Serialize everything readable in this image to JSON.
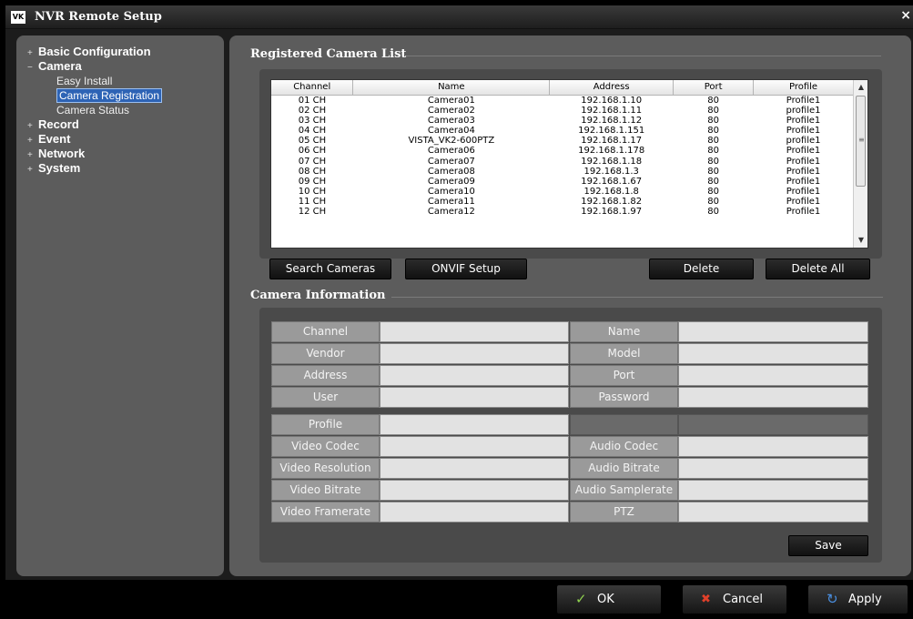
{
  "window": {
    "logo_text": "VK",
    "title": "NVR Remote Setup",
    "close_glyph": "×"
  },
  "tree": {
    "items": [
      {
        "label": "Basic Configuration",
        "expander": "+",
        "level": 0
      },
      {
        "label": "Camera",
        "expander": "−",
        "level": 0
      },
      {
        "label": "Easy Install",
        "level": 1
      },
      {
        "label": "Camera Registration",
        "level": 1,
        "selected": true
      },
      {
        "label": "Camera Status",
        "level": 1
      },
      {
        "label": "Record",
        "expander": "+",
        "level": 0
      },
      {
        "label": "Event",
        "expander": "+",
        "level": 0
      },
      {
        "label": "Network",
        "expander": "+",
        "level": 0
      },
      {
        "label": "System",
        "expander": "+",
        "level": 0
      }
    ]
  },
  "registered": {
    "title": "Registered Camera List",
    "columns": [
      "Channel",
      "Name",
      "Address",
      "Port",
      "Profile"
    ],
    "rows": [
      [
        "01 CH",
        "Camera01",
        "192.168.1.10",
        "80",
        "Profile1"
      ],
      [
        "02 CH",
        "Camera02",
        "192.168.1.11",
        "80",
        "profile1"
      ],
      [
        "03 CH",
        "Camera03",
        "192.168.1.12",
        "80",
        "Profile1"
      ],
      [
        "04 CH",
        "Camera04",
        "192.168.1.151",
        "80",
        "Profile1"
      ],
      [
        "05 CH",
        "VISTA_VK2-600PTZ",
        "192.168.1.17",
        "80",
        "profile1"
      ],
      [
        "06 CH",
        "Camera06",
        "192.168.1.178",
        "80",
        "Profile1"
      ],
      [
        "07 CH",
        "Camera07",
        "192.168.1.18",
        "80",
        "Profile1"
      ],
      [
        "08 CH",
        "Camera08",
        "192.168.1.3",
        "80",
        "Profile1"
      ],
      [
        "09 CH",
        "Camera09",
        "192.168.1.67",
        "80",
        "Profile1"
      ],
      [
        "10 CH",
        "Camera10",
        "192.168.1.8",
        "80",
        "Profile1"
      ],
      [
        "11 CH",
        "Camera11",
        "192.168.1.82",
        "80",
        "Profile1"
      ],
      [
        "12 CH",
        "Camera12",
        "192.168.1.97",
        "80",
        "Profile1"
      ]
    ],
    "scroll_up": "▲",
    "scroll_down": "▼",
    "scroll_grip": "≡",
    "buttons": {
      "search": "Search Cameras",
      "onvif": "ONVIF Setup",
      "delete": "Delete",
      "delete_all": "Delete All"
    }
  },
  "info": {
    "title": "Camera Information",
    "fields": {
      "channel": "Channel",
      "name": "Name",
      "vendor": "Vendor",
      "model": "Model",
      "address": "Address",
      "port": "Port",
      "user": "User",
      "password": "Password",
      "profile": "Profile",
      "video_codec": "Video Codec",
      "audio_codec": "Audio Codec",
      "video_resolution": "Video Resolution",
      "audio_bitrate": "Audio Bitrate",
      "video_bitrate": "Video Bitrate",
      "audio_samplerate": "Audio Samplerate",
      "video_framerate": "Video Framerate",
      "ptz": "PTZ"
    },
    "save": "Save"
  },
  "footer": {
    "ok": "OK",
    "ok_icon": "✓",
    "cancel": "Cancel",
    "cancel_icon": "✖",
    "apply": "Apply",
    "apply_icon": "↻"
  },
  "colors": {
    "ok_icon": "#8fd14f",
    "cancel_icon": "#e0402a",
    "apply_icon": "#4a8fe0",
    "selection": "#2d63b5"
  }
}
